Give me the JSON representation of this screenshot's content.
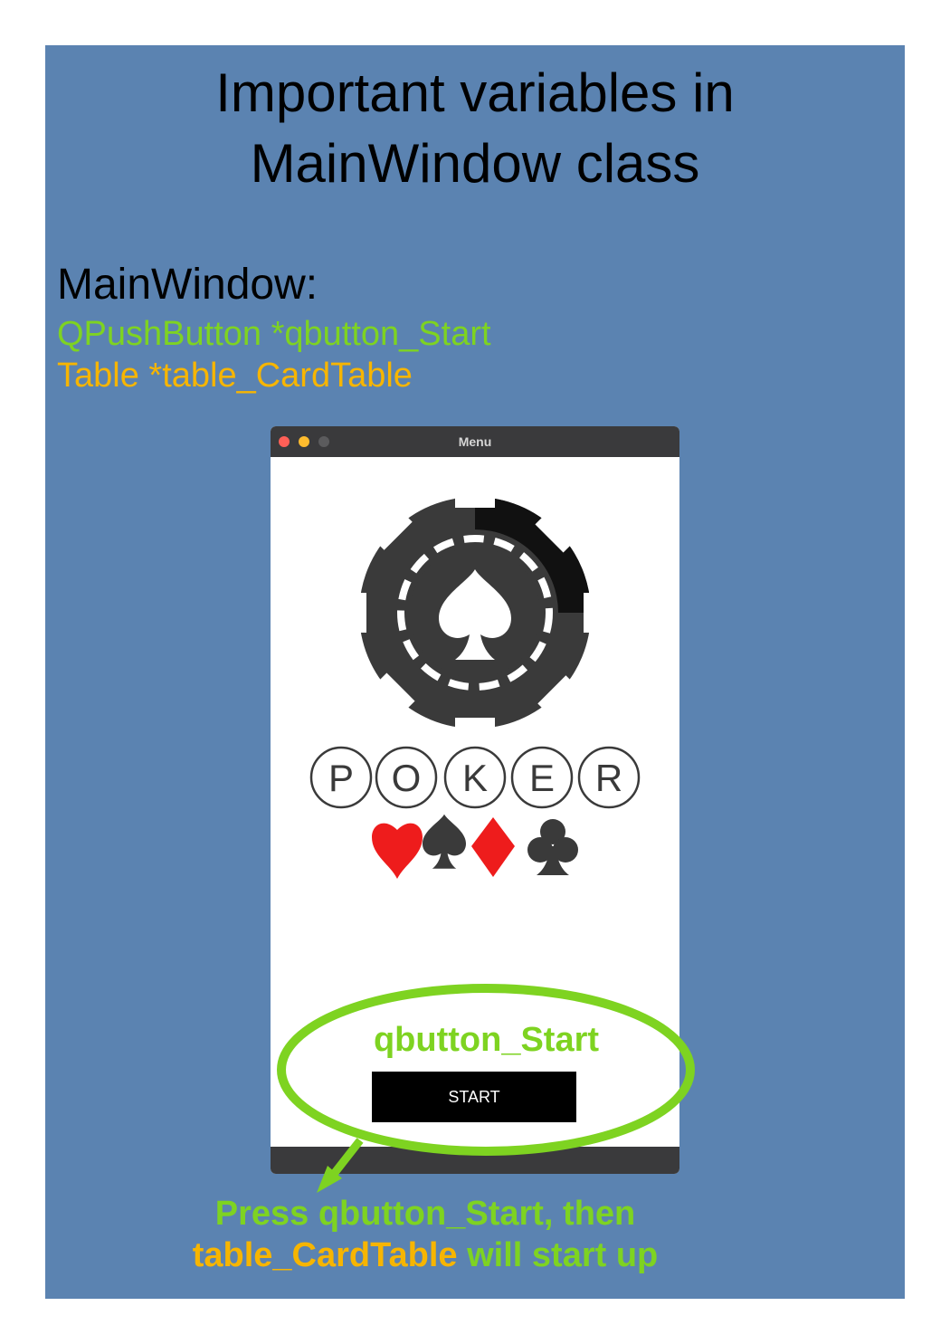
{
  "slide": {
    "title_line1": "Important variables in",
    "title_line2": "MainWindow class",
    "section_heading": "MainWindow:",
    "variables": [
      {
        "text": "QPushButton *qbutton_Start",
        "color": "#7ed321"
      },
      {
        "text": "Table *table_CardTable",
        "color": "#f7b500"
      }
    ],
    "background_color": "#5b83b1"
  },
  "app_window": {
    "title": "Menu",
    "logo": {
      "letters": [
        "P",
        "O",
        "K",
        "E",
        "R"
      ],
      "suits": [
        {
          "icon": "heart-icon",
          "color": "#ee1c1c"
        },
        {
          "icon": "spade-icon",
          "color": "#3a3a3a"
        },
        {
          "icon": "diamond-icon",
          "color": "#ee1c1c"
        },
        {
          "icon": "club-icon",
          "color": "#3a3a3a"
        }
      ]
    },
    "start_button_label": "START"
  },
  "annotation": {
    "ellipse_label": "qbutton_Start",
    "caption_part1": "Press qbutton_Start, then",
    "caption_part2_highlight": "table_CardTable",
    "caption_part3": " will start up",
    "green": "#7ed321",
    "yellow": "#f7b500"
  }
}
